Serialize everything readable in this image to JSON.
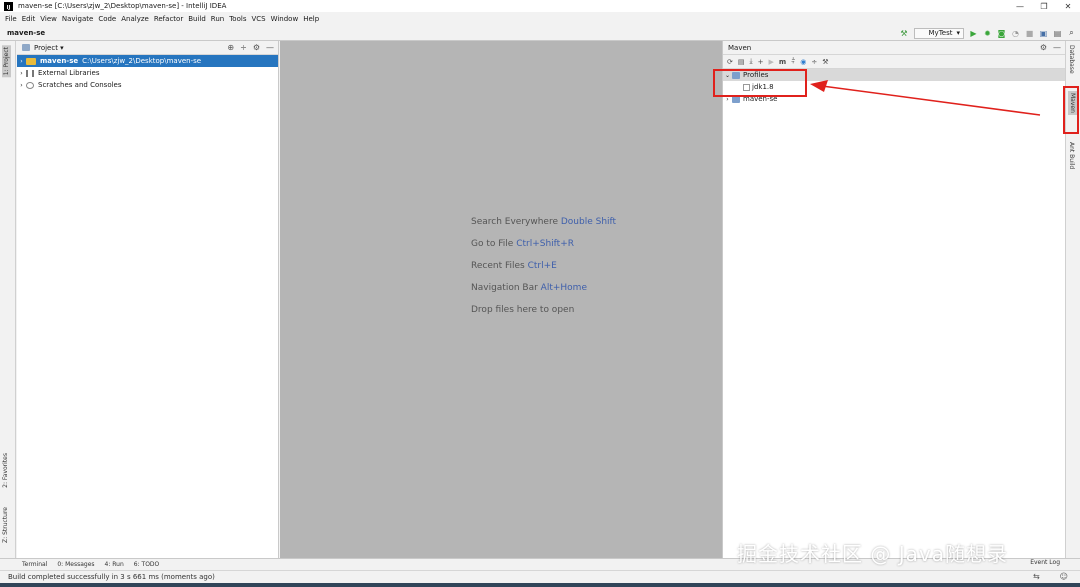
{
  "titlebar": {
    "icon_label": "IJ",
    "title": "maven-se [C:\\Users\\zjw_2\\Desktop\\maven-se] - IntelliJ IDEA",
    "minimize": "—",
    "maximize": "❐",
    "close": "✕"
  },
  "menu": [
    "File",
    "Edit",
    "View",
    "Navigate",
    "Code",
    "Analyze",
    "Refactor",
    "Build",
    "Run",
    "Tools",
    "VCS",
    "Window",
    "Help"
  ],
  "navbar": {
    "breadcrumb": "maven-se",
    "run_config": "MyTest"
  },
  "left_strip": {
    "project": "1: Project",
    "favorites": "2: Favorites",
    "structure": "Z: Structure"
  },
  "right_strip": {
    "database": "Database",
    "maven": "Maven",
    "ant": "Ant Build"
  },
  "project_panel": {
    "title": "Project ▾",
    "items": [
      {
        "name": "maven-se",
        "path": "C:\\Users\\zjw_2\\Desktop\\maven-se"
      },
      {
        "name": "External Libraries"
      },
      {
        "name": "Scratches and Consoles"
      }
    ]
  },
  "editor": {
    "hints": [
      {
        "text": "Search Everywhere",
        "key": "Double Shift"
      },
      {
        "text": "Go to File",
        "key": "Ctrl+Shift+R"
      },
      {
        "text": "Recent Files",
        "key": "Ctrl+E"
      },
      {
        "text": "Navigation Bar",
        "key": "Alt+Home"
      },
      {
        "text": "Drop files here to open",
        "key": ""
      }
    ]
  },
  "maven_panel": {
    "title": "Maven",
    "toolbar_icon_m": "m",
    "tree": {
      "profiles": "Profiles",
      "profile_items": [
        "jdk1.8"
      ],
      "project": "maven-se"
    }
  },
  "bottom_tabs": [
    "Terminal",
    "0: Messages",
    "4: Run",
    "6: TODO"
  ],
  "event_log": "Event Log",
  "status": {
    "message": "Build completed successfully in 3 s 661 ms (moments ago)"
  },
  "watermark": "掘金技术社区 @ Java随想录",
  "colors": {
    "highlight": "#e0211c",
    "selection": "#2675bf",
    "editor_bg": "#b5b5b5",
    "key_color": "#3e5fab"
  }
}
